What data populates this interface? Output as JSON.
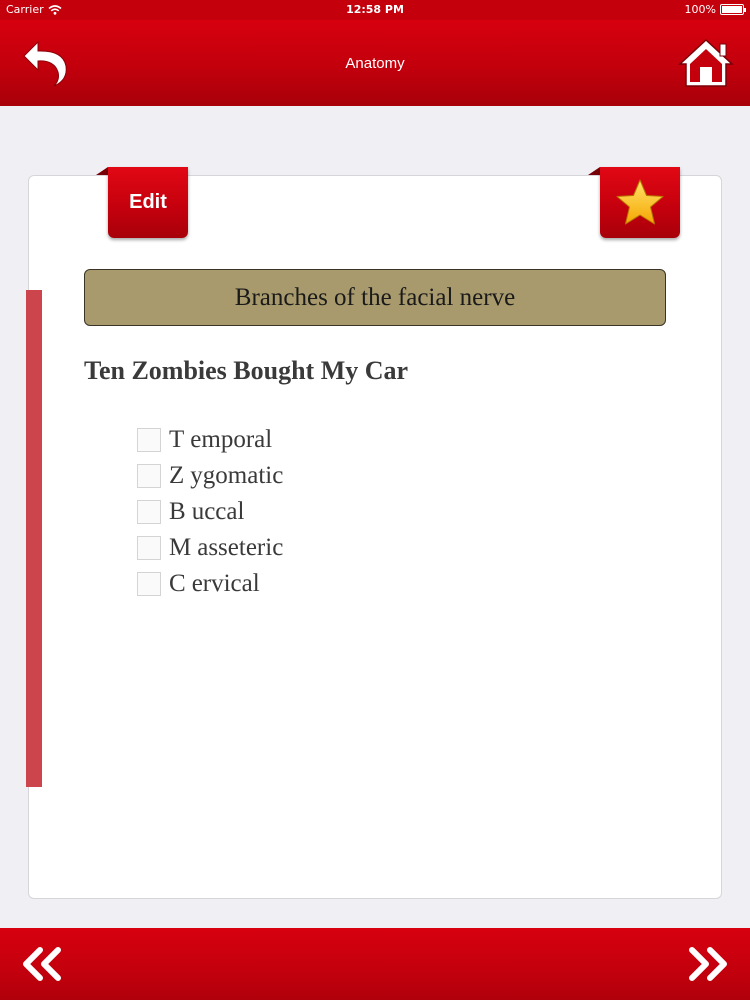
{
  "status_bar": {
    "carrier": "Carrier",
    "time": "12:58 PM",
    "battery": "100%"
  },
  "nav": {
    "title": "Anatomy"
  },
  "card": {
    "edit_label": "Edit",
    "topic": "Branches of the facial nerve",
    "mnemonic": "Ten Zombies Bought My Car",
    "terms": [
      {
        "initial": "T",
        "rest": "emporal",
        "checked": false
      },
      {
        "initial": "Z",
        "rest": "ygomatic",
        "checked": false
      },
      {
        "initial": "B",
        "rest": "uccal",
        "checked": false
      },
      {
        "initial": "M",
        "rest": "asseteric",
        "checked": false
      },
      {
        "initial": "C",
        "rest": "ervical",
        "checked": false
      }
    ]
  },
  "colors": {
    "brand_red": "#c4000c",
    "banner": "#a89a6c",
    "accent": "#cc444c",
    "star": "#ffc21a"
  },
  "icons": {
    "back": "back-arrow-icon",
    "home": "home-icon",
    "favorite": "star-icon",
    "previous": "double-chevron-left-icon",
    "next": "double-chevron-right-icon"
  }
}
